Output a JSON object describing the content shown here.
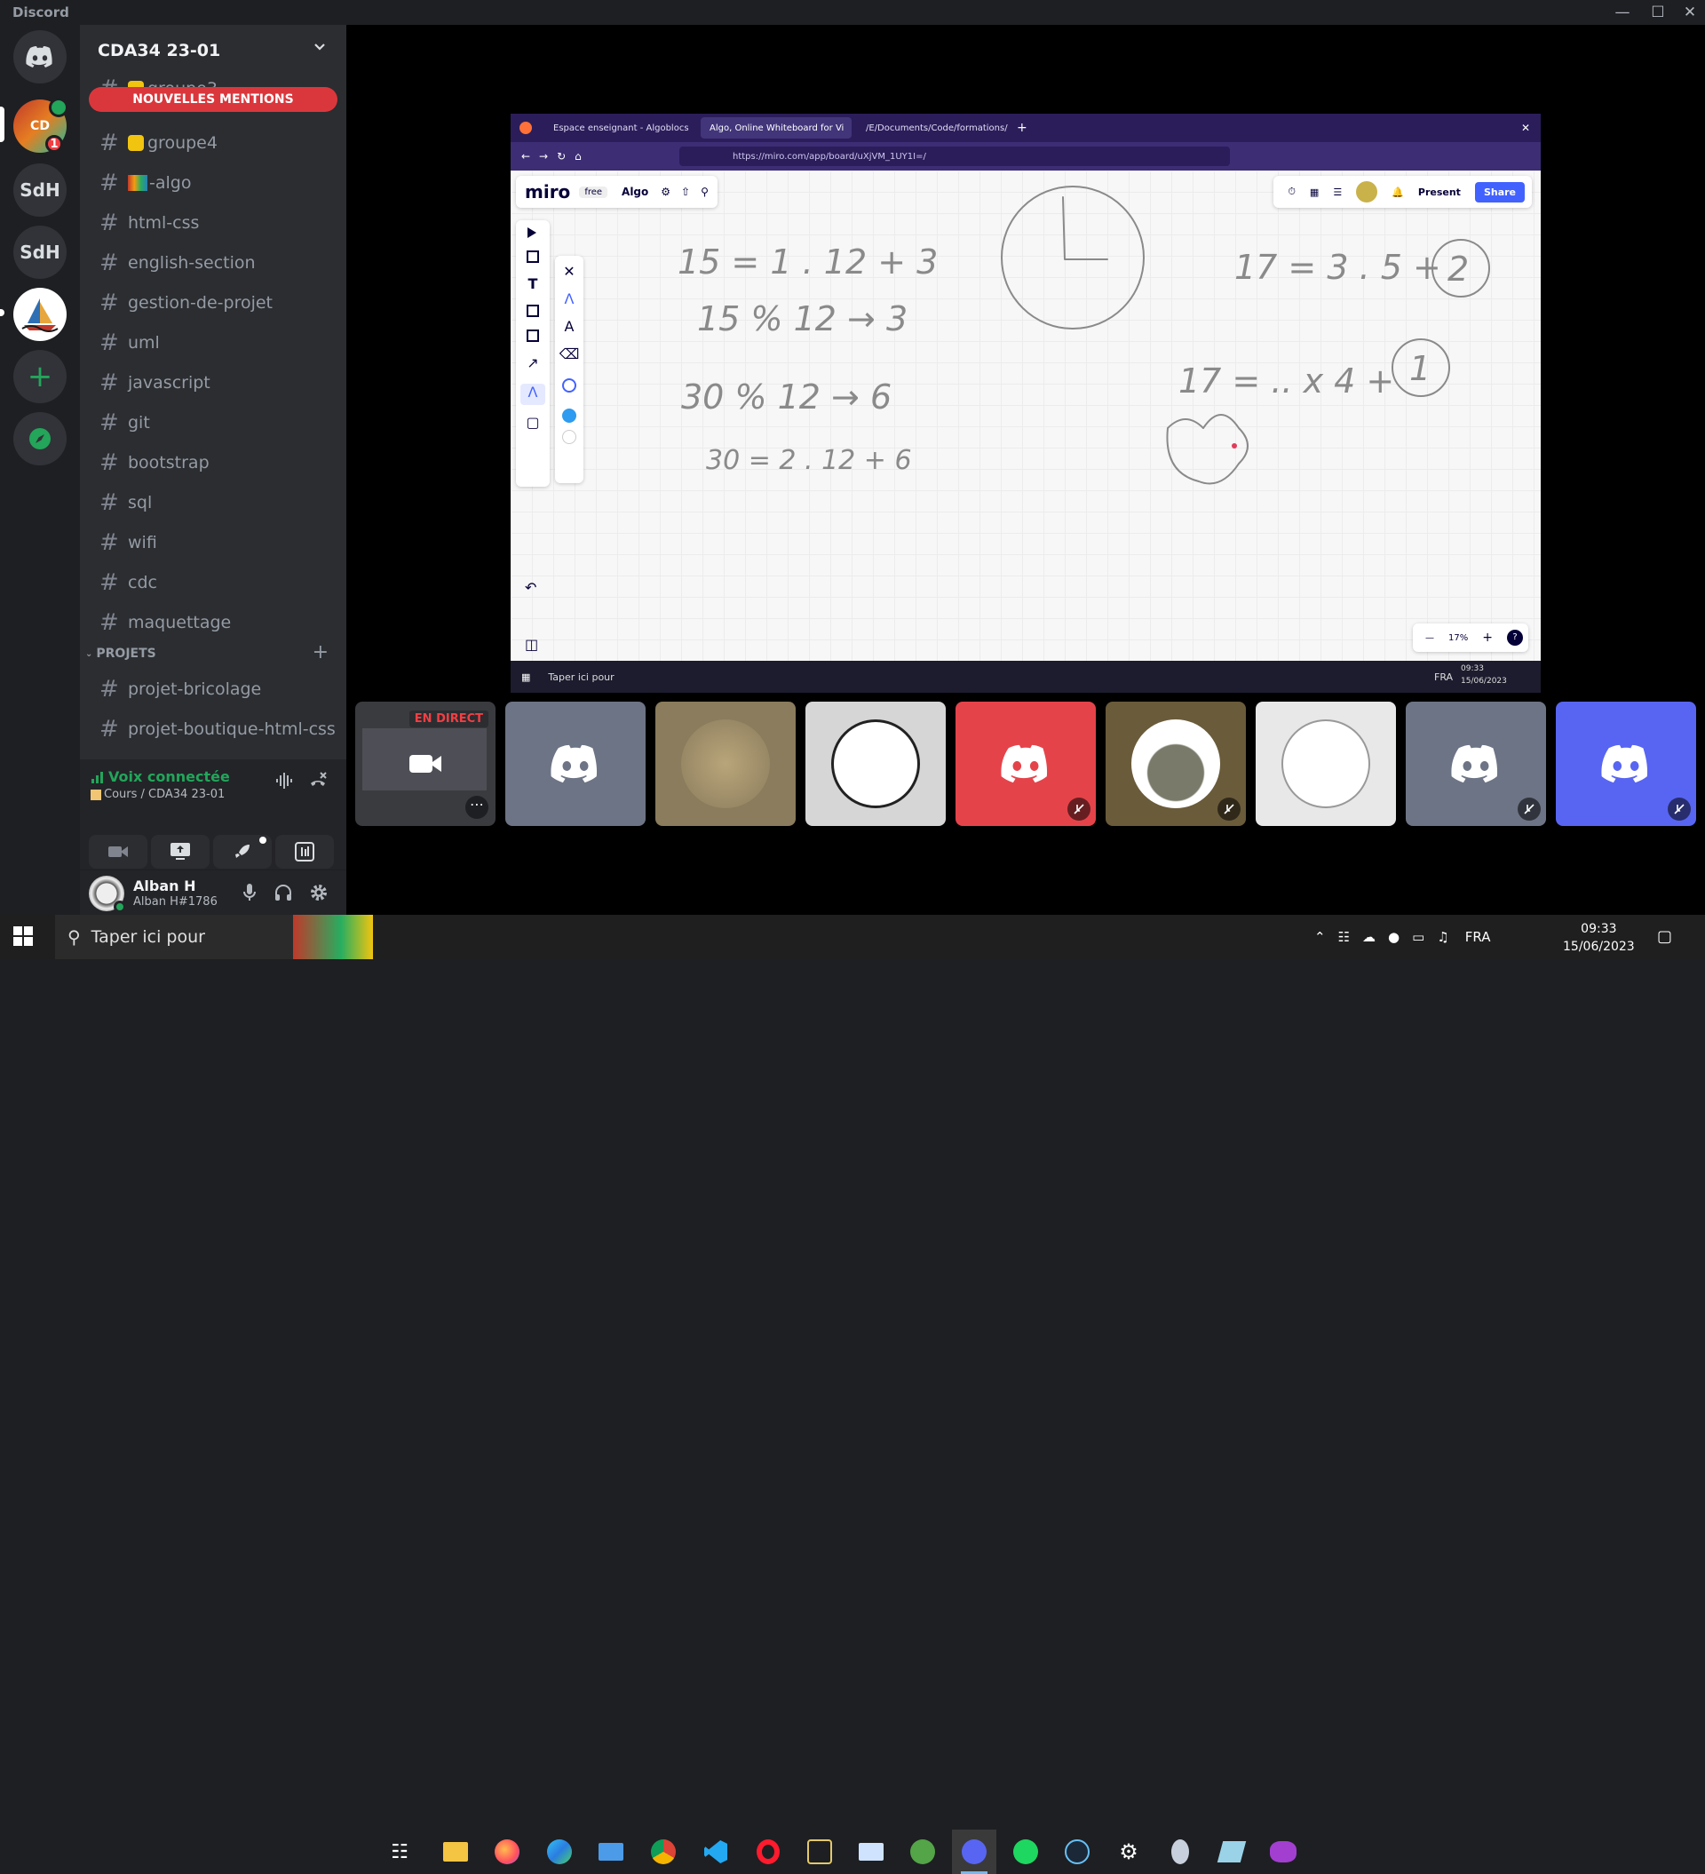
{
  "app": {
    "title": "Discord"
  },
  "servers": {
    "badge_count": "1",
    "items": [
      "SdH",
      "SdH"
    ]
  },
  "channel_sidebar": {
    "server_name": "CDA34 23-01",
    "new_mentions": "NOUVELLES MENTIONS",
    "channels": [
      "groupe3",
      "groupe4",
      "-algo",
      "html-css",
      "english-section",
      "gestion-de-projet",
      "uml",
      "javascript",
      "git",
      "bootstrap",
      "sql",
      "wifi",
      "cdc",
      "maquettage"
    ],
    "category": "PROJETS",
    "project_channels": [
      "projet-bricolage",
      "projet-boutique-html-css"
    ]
  },
  "voice": {
    "status": "Voix connectée",
    "location": "Cours / CDA34 23-01"
  },
  "user": {
    "name": "Alban H",
    "tag": "Alban H#1786"
  },
  "screen_share": {
    "tabs": [
      "Espace enseignant - Algoblocs",
      "Algo, Online Whiteboard for Vi",
      "/E/Documents/Code/formations/C"
    ],
    "url": "https://miro.com/app/board/uXjVM_1UY1I=/",
    "miro": {
      "logo": "miro",
      "plan": "free",
      "board_name": "Algo",
      "present": "Present",
      "share": "Share",
      "zoom": "17%"
    },
    "taskbar": {
      "search": "Taper ici pour",
      "lang": "FRA",
      "time": "09:33",
      "date": "15/06/2023"
    }
  },
  "stream": {
    "live_label": "EN DIRECT"
  },
  "taskbar": {
    "search_placeholder": "Taper ici pour",
    "lang": "FRA",
    "time": "09:33",
    "date": "15/06/2023"
  }
}
